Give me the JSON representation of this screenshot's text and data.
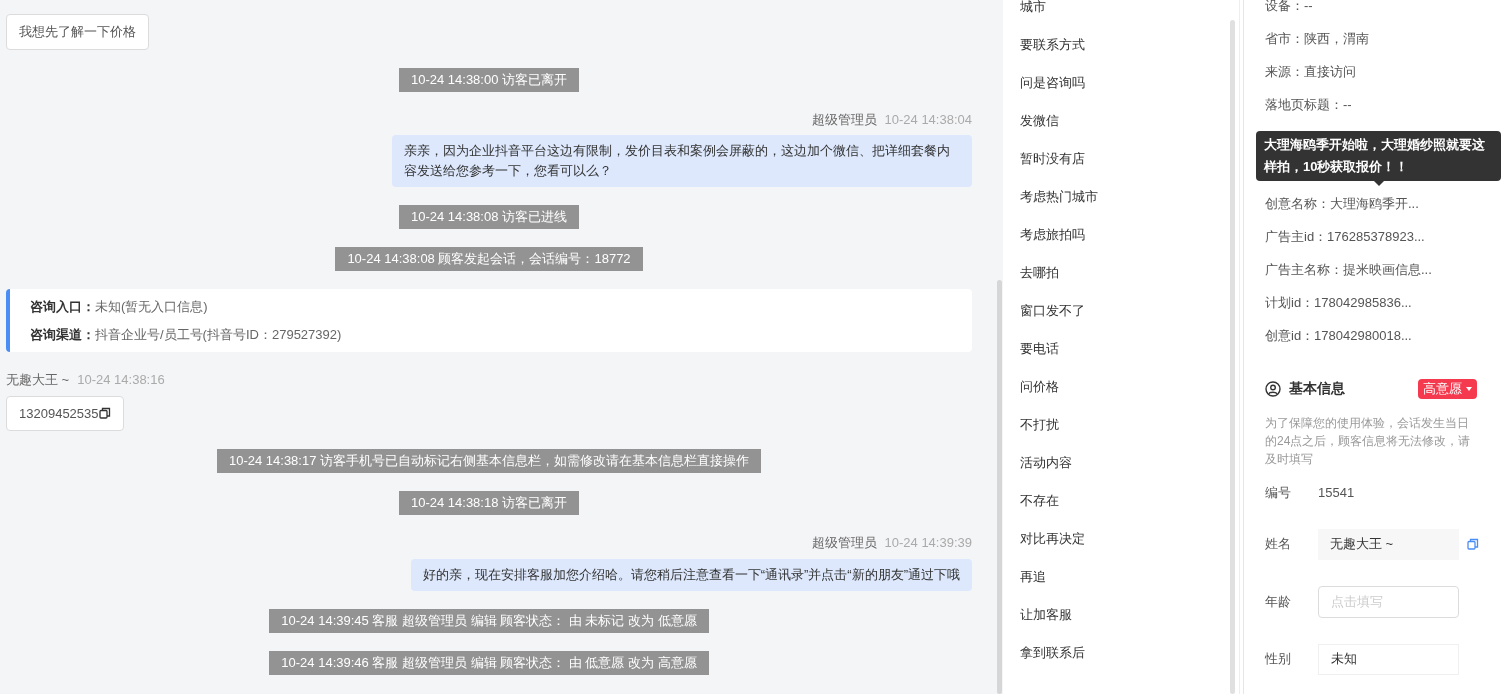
{
  "chat": {
    "messages": [
      {
        "kind": "customer",
        "text": "我想先了解一下价格"
      },
      {
        "kind": "system",
        "text": "10-24 14:38:00 访客已离开"
      },
      {
        "kind": "agent",
        "name": "超级管理员",
        "time": "10-24 14:38:04",
        "text": "亲亲，因为企业抖音平台这边有限制，发价目表和案例会屏蔽的，这边加个微信、把详细套餐内容发送给您参考一下，您看可以么？"
      },
      {
        "kind": "system",
        "text": "10-24 14:38:08 访客已进线"
      },
      {
        "kind": "system",
        "text": "10-24 14:38:08 顾客发起会话，会话编号：18772"
      },
      {
        "kind": "card",
        "lines": [
          {
            "label": "咨询入口：",
            "value": "未知(暂无入口信息)"
          },
          {
            "label": "咨询渠道：",
            "value": "抖音企业号/员工号(抖音号ID：279527392)"
          }
        ]
      },
      {
        "kind": "customer",
        "name": "无趣大王 ~",
        "time": "10-24 14:38:16",
        "text": "13209452535",
        "copy": true
      },
      {
        "kind": "system",
        "text": "10-24 14:38:17 访客手机号已自动标记右侧基本信息栏，如需修改请在基本信息栏直接操作"
      },
      {
        "kind": "system",
        "text": "10-24 14:38:18 访客已离开"
      },
      {
        "kind": "agent",
        "name": "超级管理员",
        "time": "10-24 14:39:39",
        "text": "好的亲，现在安排客服加您介绍哈。请您稍后注意查看一下“通讯录”并点击“新的朋友”通过下哦"
      },
      {
        "kind": "system",
        "text": "10-24 14:39:45 客服 超级管理员 编辑 顾客状态： 由 未标记 改为 低意愿"
      },
      {
        "kind": "system",
        "text": "10-24 14:39:46 客服 超级管理员 编辑 顾客状态： 由 低意愿 改为 高意愿"
      }
    ]
  },
  "quick_replies": [
    "城市",
    "要联系方式",
    "问是咨询吗",
    "发微信",
    "暂时没有店",
    "考虑热门城市",
    "考虑旅拍吗",
    "去哪拍",
    "窗口发不了",
    "要电话",
    "问价格",
    "不打扰",
    "活动内容",
    "不存在",
    "对比再决定",
    "再追",
    "让加客服",
    "拿到联系后"
  ],
  "source_info": {
    "rows": [
      {
        "kind": "row",
        "text": "设备：--"
      },
      {
        "kind": "row",
        "text": "省市：陕西，渭南"
      },
      {
        "kind": "row",
        "text": "来源：直接访问"
      },
      {
        "kind": "row",
        "text": "落地页标题：--"
      },
      {
        "kind": "hidden"
      },
      {
        "kind": "hidden"
      },
      {
        "kind": "row",
        "text": "创意名称：大理海鸥季开..."
      },
      {
        "kind": "row",
        "text": "广告主id：176285378923..."
      },
      {
        "kind": "row",
        "text": "广告主名称：提米映画信息..."
      },
      {
        "kind": "row",
        "text": "计划id：178042985836..."
      },
      {
        "kind": "row",
        "text": "创意id：178042980018..."
      }
    ],
    "tooltip": "大理海鸥季开始啦，大理婚纱照就要这样拍，10秒获取报价！！"
  },
  "basic_info": {
    "title": "基本信息",
    "intent": "高意愿",
    "notice": "为了保障您的使用体验，会话发生当日的24点之后，顾客信息将无法修改，请及时填写",
    "fields": [
      {
        "kind": "text",
        "label": "编号",
        "value": "15541"
      },
      {
        "kind": "readonly",
        "label": "姓名",
        "value": "无趣大王 ~",
        "copy": true
      },
      {
        "kind": "input",
        "label": "年龄",
        "placeholder": "点击填写"
      },
      {
        "kind": "select",
        "label": "性别",
        "value": "未知"
      }
    ]
  }
}
